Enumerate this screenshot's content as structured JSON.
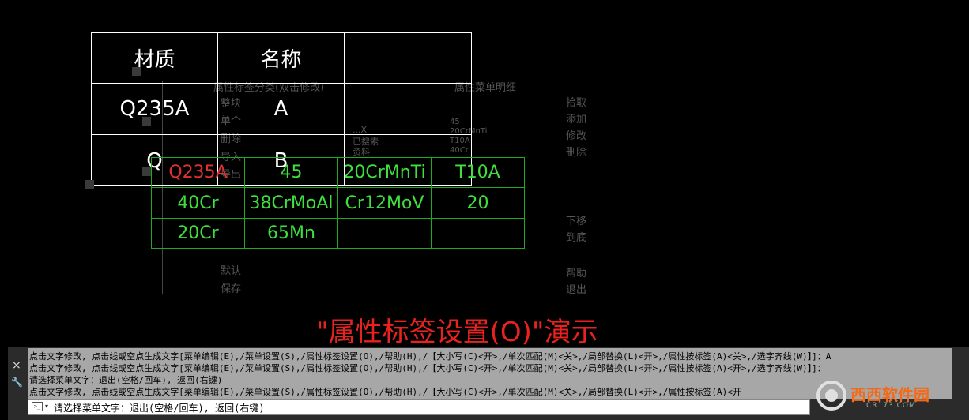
{
  "drawing": {
    "header_material": "材质",
    "header_name": "名称",
    "row1_material": "Q235A",
    "row1_name": "A",
    "row2_material": "Q",
    "row2_name": "B"
  },
  "ghost_menu": {
    "left_title": "属性标签分类(双击修改)",
    "right_title": "属性菜单明细",
    "left_items": [
      "整块",
      "单个",
      "删除",
      "导入",
      "导出",
      "默认",
      "保存"
    ],
    "right_actions": [
      "拾取",
      "添加",
      "修改",
      "删除",
      "下移",
      "到底",
      "帮助",
      "退出"
    ],
    "mid_items": [
      "...X",
      "已搜索",
      "资料"
    ],
    "detail_items": [
      "45",
      "20CrMnTi",
      "T10A",
      "40Cr",
      "38CrMoAl",
      "Cr12MoV",
      "20",
      "65Mn"
    ]
  },
  "green_table": {
    "rows": [
      [
        "Q235A",
        "45",
        "20CrMnTi",
        "T10A"
      ],
      [
        "40Cr",
        "38CrMoAl",
        "Cr12MoV",
        "20"
      ],
      [
        "20Cr",
        "65Mn",
        "",
        ""
      ]
    ],
    "selected": "Q235A"
  },
  "caption": "\"属性标签设置(O)\"演示",
  "command_line": {
    "history": [
      "点击文字修改, 点击线或空点生成文字[菜单编辑(E),/菜单设置(S),/属性标签设置(O),/帮助(H),/【大小写(C)<开>,/单次匹配(M)<关>,/局部替换(L)<开>,/属性按标签(A)<关>,/选字齐线(W)】]：A",
      "点击文字修改, 点击线或空点生成文字[菜单编辑(E),/菜单设置(S),/属性标签设置(O),/帮助(H),/【大小写(C)<开>,/单次匹配(M)<关>,/局部替换(L)<开>,/属性按标签(A)<开>,/选字齐线(W)】]：",
      "请选择菜单文字：退出(空格/回车), 返回(右键)",
      "点击文字修改, 点击线或空点生成文字[菜单编辑(E),/菜单设置(S),/属性标签设置(O),/帮助(H),/【大小写(C)<开>,/单次匹配(M)<关>,/局部替换(L)<开>,/属性按标签(A)<开"
    ],
    "prompt": "请选择菜单文字：退出(空格/回车), 返回(右键)",
    "close_glyph": "×",
    "wrench_glyph": "🔧",
    "prompt_glyph": ">_"
  },
  "watermark": {
    "brand": "西西软件园",
    "url": "CR173.COM"
  }
}
